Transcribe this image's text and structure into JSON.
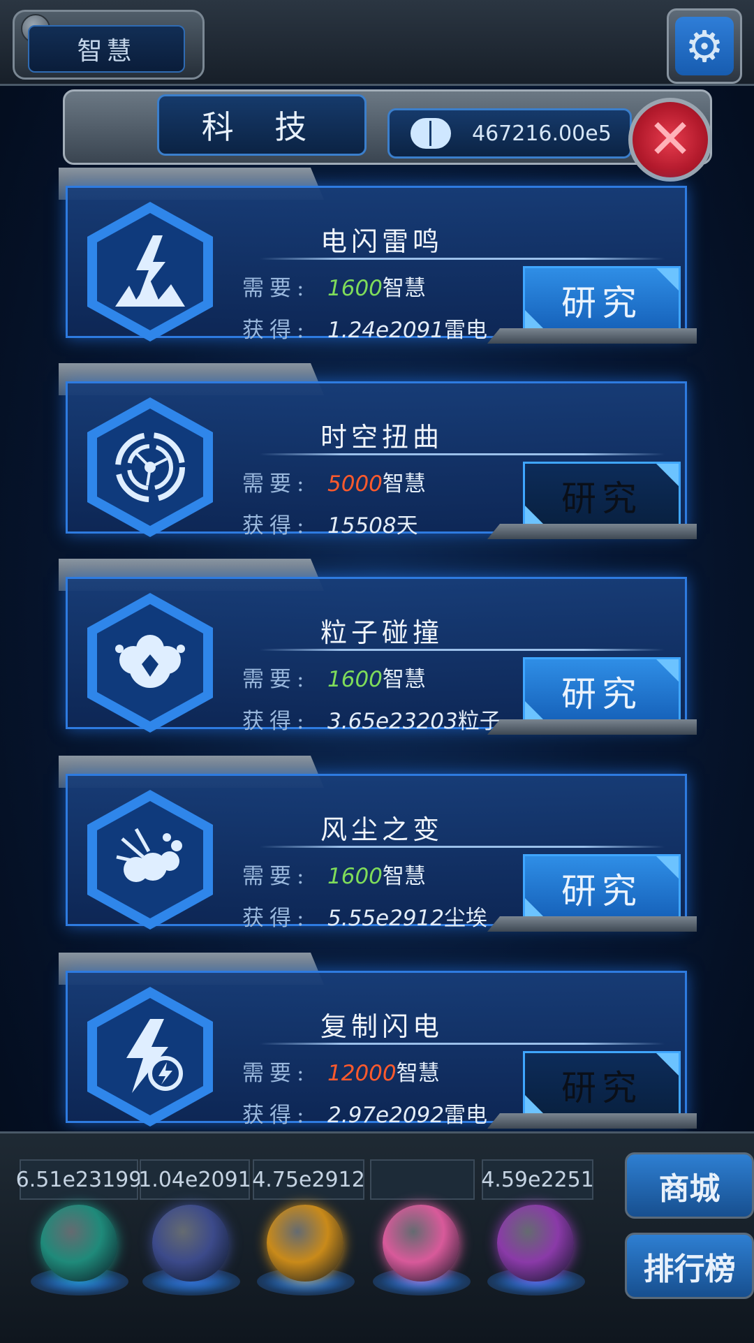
{
  "top": {
    "wisdom_tab": "智慧",
    "settings_icon": "gear-icon"
  },
  "header": {
    "title": "科 技",
    "resource_icon": "brain-icon",
    "resource_value": "467216.00e5",
    "close_icon": "close-icon"
  },
  "cards": [
    {
      "title": "电闪雷鸣",
      "need_label": "需要:",
      "need_amount": "1600",
      "need_unit": "智慧",
      "need_color": "#7fdc5a",
      "gain_label": "获得:",
      "gain_value": "1.24e2091",
      "gain_unit": "雷电",
      "button": "研究",
      "button_enabled": true,
      "icon": "lightning-strike-icon"
    },
    {
      "title": "时空扭曲",
      "need_label": "需要:",
      "need_amount": "5000",
      "need_unit": "智慧",
      "need_color": "#ff5a2c",
      "gain_label": "获得:",
      "gain_value": "15508",
      "gain_unit": "天",
      "button": "研究",
      "button_enabled": false,
      "icon": "vortex-icon"
    },
    {
      "title": "粒子碰撞",
      "need_label": "需要:",
      "need_amount": "1600",
      "need_unit": "智慧",
      "need_color": "#7fdc5a",
      "gain_label": "获得:",
      "gain_value": "3.65e23203",
      "gain_unit": "粒子",
      "button": "研究",
      "button_enabled": true,
      "icon": "explosion-icon"
    },
    {
      "title": "风尘之变",
      "need_label": "需要:",
      "need_amount": "1600",
      "need_unit": "智慧",
      "need_color": "#7fdc5a",
      "gain_label": "获得:",
      "gain_value": "5.55e2912",
      "gain_unit": "尘埃",
      "button": "研究",
      "button_enabled": true,
      "icon": "dust-cloud-icon"
    },
    {
      "title": "复制闪电",
      "need_label": "需要:",
      "need_amount": "12000",
      "need_unit": "智慧",
      "need_color": "#ff5a2c",
      "gain_label": "获得:",
      "gain_value": "2.97e2092",
      "gain_unit": "雷电",
      "button": "研究",
      "button_enabled": false,
      "icon": "lightning-copy-icon"
    }
  ],
  "bottom": {
    "resources": [
      "6.51e23199",
      "1.04e2091",
      "4.75e2912",
      "",
      "4.59e2251"
    ],
    "orbs": [
      {
        "icon": "atom-orb-icon",
        "color": "#1f8a7a"
      },
      {
        "icon": "lightning-orb-icon",
        "color": "#3c4a8a"
      },
      {
        "icon": "fire-orb-icon",
        "color": "#c98a1a"
      },
      {
        "icon": "network-orb-icon",
        "color": "#d85a9a"
      },
      {
        "icon": "portal-orb-icon",
        "color": "#8a3aa8"
      }
    ],
    "shop_label": "商城",
    "ranking_label": "排行榜"
  }
}
